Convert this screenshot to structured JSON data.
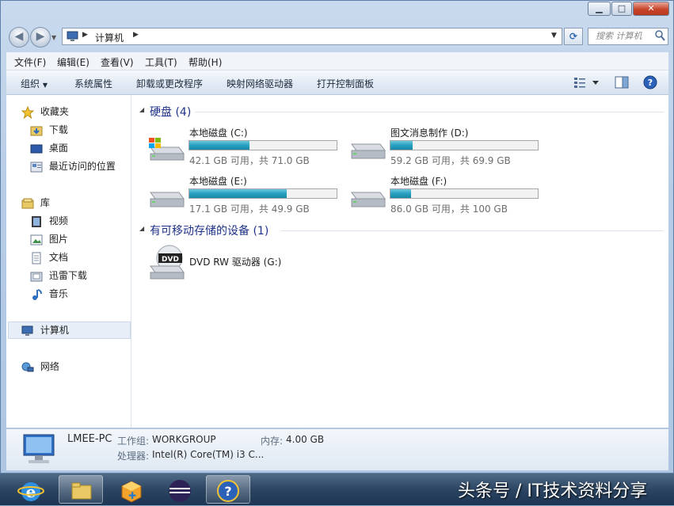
{
  "window": {
    "controls": {
      "minimize": "▁",
      "maximize": "□",
      "close": "✕"
    }
  },
  "nav": {
    "breadcrumb": [
      "计算机"
    ],
    "search_placeholder": "搜索 计算机"
  },
  "menu": [
    "文件(F)",
    "编辑(E)",
    "查看(V)",
    "工具(T)",
    "帮助(H)"
  ],
  "toolbar": {
    "organize": "组织",
    "items": [
      "系统属性",
      "卸载或更改程序",
      "映射网络驱动器",
      "打开控制面板"
    ]
  },
  "sidebar": {
    "favorites": {
      "label": "收藏夹",
      "items": [
        "下载",
        "桌面",
        "最近访问的位置"
      ]
    },
    "libraries": {
      "label": "库",
      "items": [
        "视频",
        "图片",
        "文档",
        "迅雷下载",
        "音乐"
      ]
    },
    "computer": "计算机",
    "network": "网络"
  },
  "groups": {
    "hard_disks": "硬盘 (4)",
    "removable": "有可移动存储的设备 (1)"
  },
  "drives": [
    {
      "name": "本地磁盘 (C:)",
      "free": "42.1 GB 可用，共 71.0 GB",
      "used_fraction": 0.41
    },
    {
      "name": "图文消息制作 (D:)",
      "free": "59.2 GB 可用，共 69.9 GB",
      "used_fraction": 0.15
    },
    {
      "name": "本地磁盘 (E:)",
      "free": "17.1 GB 可用，共 49.9 GB",
      "used_fraction": 0.66
    },
    {
      "name": "本地磁盘 (F:)",
      "free": "86.0 GB 可用，共 100 GB",
      "used_fraction": 0.14
    }
  ],
  "dvd": {
    "name": "DVD RW 驱动器 (G:)",
    "badge": "DVD"
  },
  "details": {
    "pc_name": "LMEE-PC",
    "workgroup_label": "工作组:",
    "workgroup": "WORKGROUP",
    "memory_label": "内存:",
    "memory": "4.00 GB",
    "cpu_label": "处理器:",
    "cpu": "Intel(R) Core(TM) i3 C..."
  },
  "watermark": "头条号 / IT技术资料分享"
}
